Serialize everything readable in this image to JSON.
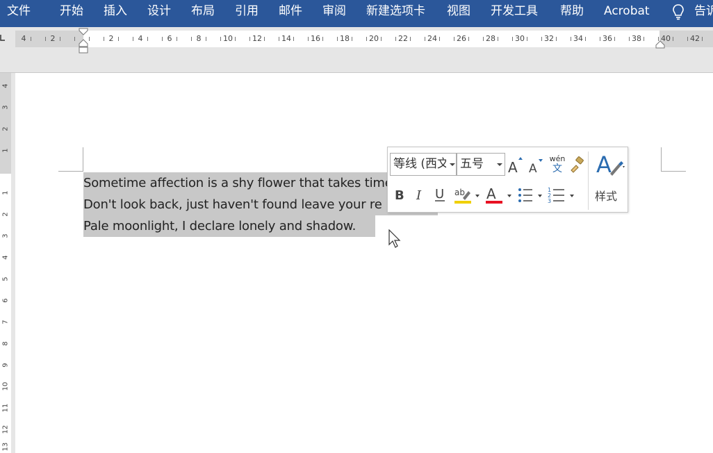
{
  "ribbon": {
    "tabs": [
      "文件",
      "开始",
      "插入",
      "设计",
      "布局",
      "引用",
      "邮件",
      "审阅",
      "新建选项卡",
      "视图",
      "开发工具",
      "帮助",
      "Acrobat"
    ],
    "tell_me": "告诉"
  },
  "ruler": {
    "horizontal_labels": [
      "4",
      "2",
      "2",
      "4",
      "6",
      "8",
      "10",
      "12",
      "14",
      "16",
      "18",
      "20",
      "22",
      "24",
      "26",
      "28",
      "30",
      "32",
      "34",
      "36",
      "38",
      "40",
      "42"
    ],
    "vertical_labels": [
      "4",
      "3",
      "2",
      "1",
      "1",
      "2",
      "1",
      "2",
      "3",
      "4",
      "5",
      "6",
      "7",
      "8",
      "9",
      "10",
      "11",
      "12",
      "13"
    ]
  },
  "document": {
    "lines": [
      "Sometime affection is a shy flower that takes time",
      "Don't look back, just haven't found leave your re",
      "Pale moonlight, I declare lonely and shadow."
    ]
  },
  "mini_toolbar": {
    "font_name": "等线 (西文",
    "font_size": "五号",
    "grow_font_icon": "grow-font-icon",
    "shrink_font_icon": "shrink-font-icon",
    "phonetic_top": "wén",
    "phonetic_bottom": "文",
    "styles_label": "样式",
    "highlight_color": "#f0d000",
    "font_color": "#e81123"
  },
  "colors": {
    "ribbon": "#2b579a",
    "selection": "#c8c8c8"
  }
}
